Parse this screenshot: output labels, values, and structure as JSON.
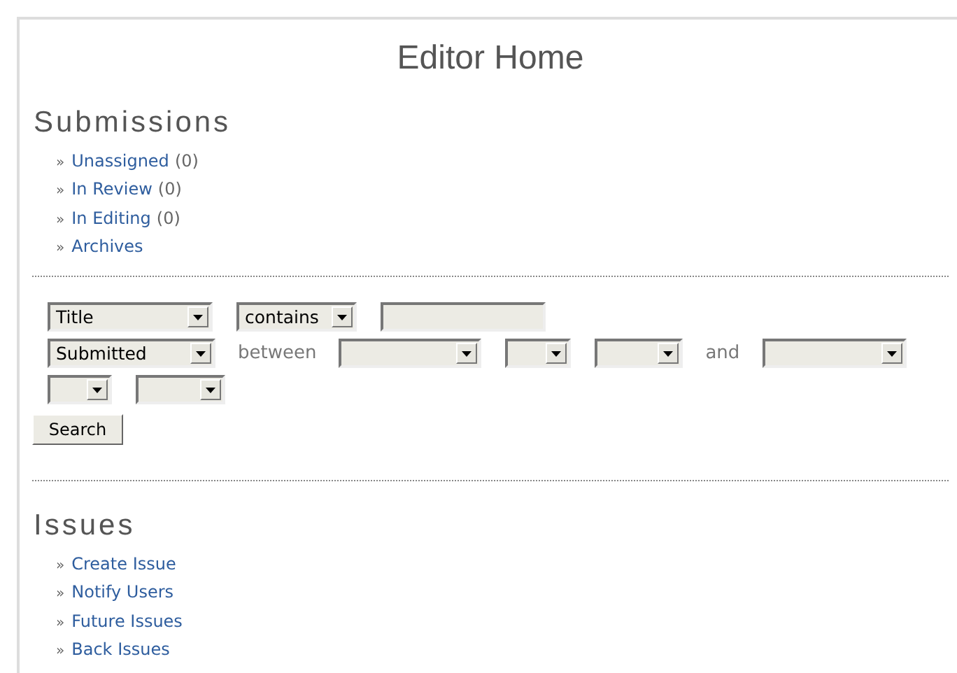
{
  "page_title": "Editor Home",
  "submissions": {
    "heading": "Submissions",
    "links": [
      {
        "marker": "»",
        "label": "Unassigned",
        "count": "(0)"
      },
      {
        "marker": "»",
        "label": "In Review",
        "count": "(0)"
      },
      {
        "marker": "»",
        "label": "In Editing",
        "count": "(0)"
      },
      {
        "marker": "»",
        "label": "Archives"
      }
    ]
  },
  "search_form": {
    "rows": [
      [
        {
          "kind": "select",
          "value": "Title"
        },
        {
          "kind": "select",
          "value": "contains"
        },
        {
          "kind": "input"
        }
      ],
      [
        {
          "kind": "select",
          "value": "Submitted"
        },
        {
          "kind": "text",
          "value": "between"
        },
        {
          "kind": "select"
        },
        {
          "kind": "select"
        },
        {
          "kind": "select"
        },
        {
          "kind": "text",
          "value": "and"
        },
        {
          "kind": "select"
        }
      ],
      [
        {
          "kind": "select"
        },
        {
          "kind": "select"
        }
      ]
    ],
    "button": "Search"
  },
  "issues": {
    "heading": "Issues",
    "links": [
      {
        "marker": "»",
        "label": "Create Issue"
      },
      {
        "marker": "»",
        "label": "Notify Users"
      },
      {
        "marker": "»",
        "label": "Future Issues"
      },
      {
        "marker": "»",
        "label": "Back Issues"
      }
    ]
  }
}
